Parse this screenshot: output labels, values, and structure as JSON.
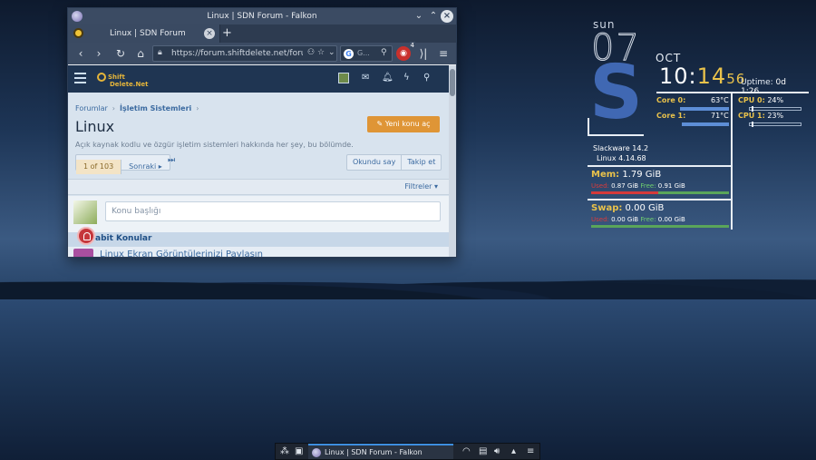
{
  "window": {
    "title": "Linux | SDN Forum - Falkon",
    "tab_label": "Linux | SDN Forum",
    "tab_close": "×",
    "new_tab": "+",
    "url": "https://forum.shiftdelete.net/forums",
    "search_placeholder": "G...",
    "ublock_badge": "4"
  },
  "site": {
    "logo_line1": "Shift",
    "logo_line2": "Delete.Net",
    "breadcrumb": [
      "Forumlar",
      "İşletim Sistemleri"
    ],
    "page_title": "Linux",
    "description": "Açık kaynak kodlu ve özgür işletim sistemleri hakkında her şey, bu bölümde.",
    "new_topic_button": "Yeni konu aç",
    "pager_current": "1 of 103",
    "pager_next": "Sonraki ▸",
    "pager_last": "⏭",
    "mark_read": "Okundu say",
    "follow": "Takip et",
    "filters": "Filtreler ▾",
    "topic_placeholder": "Konu başlığı",
    "sticky_heading": "abit Konular",
    "thread_title": "Linux Ekran Görüntülerinizi Paylaşın"
  },
  "conky": {
    "day": "sun",
    "date": "07",
    "letter": "S",
    "month": "OCT",
    "time_h": "10",
    "time_m": "14",
    "time_s": "56",
    "uptime_label": "Uptime:",
    "uptime_value": "0d 1:26",
    "core0_label": "Core 0:",
    "core0_temp": "63°C",
    "core1_label": "Core 1:",
    "core1_temp": "71°C",
    "cpu0_label": "CPU 0:",
    "cpu0_value": "24%",
    "cpu1_label": "CPU 1:",
    "cpu1_value": "23%",
    "distro": "Slackware 14.2",
    "kernel": "Linux 4.14.68",
    "mem_label": "Mem:",
    "mem_value": "1.79 GiB",
    "mem_used_label": "Used:",
    "mem_used": "0.87 GiB",
    "mem_free_label": "Free:",
    "mem_free": "0.91 GiB",
    "mem_used_fraction": 0.49,
    "swap_label": "Swap:",
    "swap_value": "0.00 GiB",
    "swap_used_label": "Used:",
    "swap_used": "0.00 GiB",
    "swap_free_label": "Free:",
    "swap_free": "0.00 GiB",
    "swap_used_fraction": 0.0
  },
  "taskbar": {
    "task_label": "Linux | SDN Forum - Falkon"
  },
  "colors": {
    "accent": "#3d8ee0",
    "conky_yellow": "#e9c24b",
    "button_orange": "#df9536"
  }
}
